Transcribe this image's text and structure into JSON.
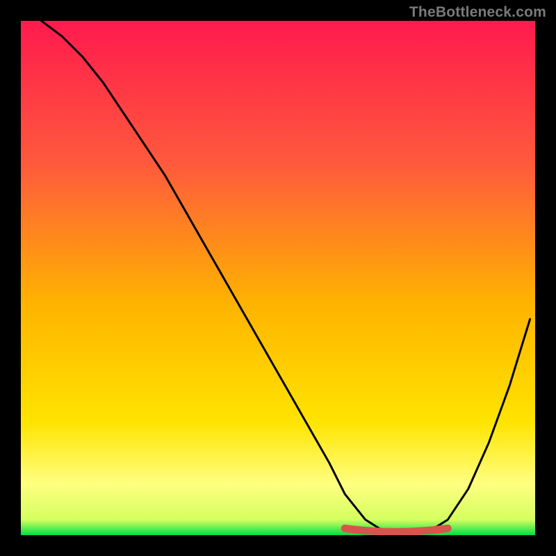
{
  "watermark": "TheBottleneck.com",
  "colors": {
    "bg": "#000000",
    "grad_top": "#ff1a4e",
    "grad_mid": "#ffd400",
    "grad_low": "#ffff66",
    "grad_bottom": "#00e040",
    "curve": "#000000",
    "marker": "#d9544d"
  },
  "chart_data": {
    "type": "line",
    "title": "",
    "xlabel": "",
    "ylabel": "",
    "xlim": [
      0,
      100
    ],
    "ylim": [
      0,
      100
    ],
    "grid": false,
    "legend": false,
    "series": [
      {
        "name": "bottleneck-curve",
        "x": [
          4,
          8,
          12,
          16,
          20,
          24,
          28,
          32,
          36,
          40,
          44,
          48,
          52,
          56,
          60,
          63,
          67,
          71,
          75,
          79,
          83,
          87,
          91,
          95,
          99
        ],
        "y": [
          100,
          97,
          93,
          88,
          82,
          76,
          70,
          63,
          56,
          49,
          42,
          35,
          28,
          21,
          14,
          8,
          3,
          0.5,
          0,
          0.5,
          3,
          9,
          18,
          29,
          42
        ]
      }
    ],
    "optimal_range": {
      "x_start": 63,
      "x_end": 83,
      "y": 0
    }
  }
}
